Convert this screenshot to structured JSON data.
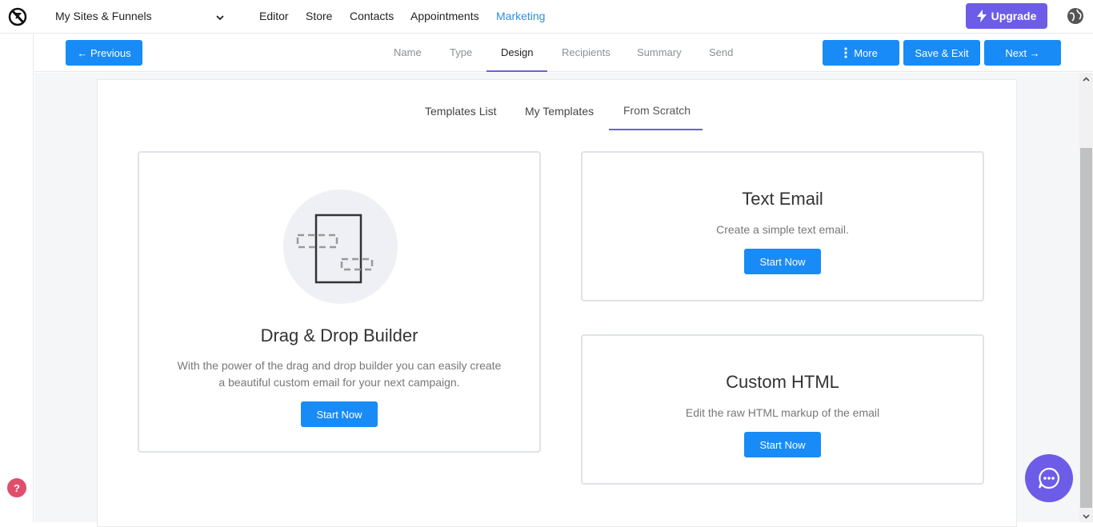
{
  "topnav": {
    "site_selector": "My Sites & Funnels",
    "links": [
      "Editor",
      "Store",
      "Contacts",
      "Appointments",
      "Marketing"
    ],
    "active_link": "Marketing",
    "upgrade_label": "Upgrade"
  },
  "stepbar": {
    "previous_label": "← Previous",
    "steps": [
      "Name",
      "Type",
      "Design",
      "Recipients",
      "Summary",
      "Send"
    ],
    "active_step": "Design",
    "more_label": "More",
    "save_exit_label": "Save & Exit",
    "next_label": "Next →"
  },
  "subtabs": {
    "items": [
      "Templates List",
      "My Templates",
      "From Scratch"
    ],
    "active": "From Scratch"
  },
  "cards": {
    "drag_drop": {
      "title": "Drag & Drop Builder",
      "desc_line1": "With the power of the drag and drop builder you can easily create",
      "desc_line2": "a beautiful custom email for your next campaign.",
      "button": "Start Now"
    },
    "text_email": {
      "title": "Text Email",
      "desc": "Create a simple text email.",
      "button": "Start Now"
    },
    "custom_html": {
      "title": "Custom HTML",
      "desc": "Edit the raw HTML markup of the email",
      "button": "Start Now"
    }
  },
  "colors": {
    "primary_blue": "#188bf6",
    "accent_purple": "#6c5ce7",
    "active_link": "#2d8ee6",
    "help_red": "#e04e6c"
  },
  "icons": [
    "logo-icon",
    "chevron-down-icon",
    "bolt-icon",
    "globe-icon",
    "kebab-icon",
    "help-icon",
    "chat-icon",
    "drag-drop-builder-icon"
  ]
}
